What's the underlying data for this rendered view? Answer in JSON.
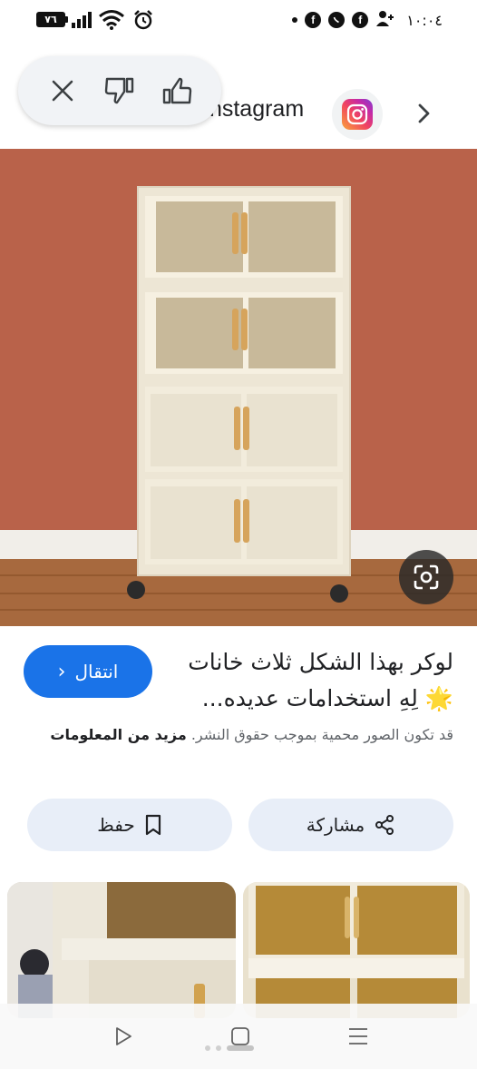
{
  "status_bar": {
    "battery": "٧٦",
    "time": "١٠:٠٤",
    "icons": [
      "battery-icon",
      "signal-icon",
      "wifi-icon",
      "alarm-icon",
      "notification-dot-icon",
      "facebook-icon",
      "whatsapp-icon",
      "facebook-icon",
      "add-contact-icon"
    ]
  },
  "header": {
    "source_name": "Instagram",
    "feedback_icons": [
      "close-icon",
      "thumbs-down-icon",
      "thumbs-up-icon"
    ]
  },
  "result": {
    "title": "لوكر بهذا الشكل ثلاث خانات 🌟 لِهِ استخدامات عديده...",
    "visit_label": "انتقال",
    "copyright_text": "قد تكون الصور محمية بموجب حقوق النشر.",
    "more_info_label": "مزيد من المعلومات"
  },
  "actions": {
    "share_label": "مشاركة",
    "save_label": "حفظ"
  },
  "colors": {
    "accent_blue": "#1a73e8",
    "pill_background": "#e8eef8",
    "wall": "#b75e45"
  }
}
